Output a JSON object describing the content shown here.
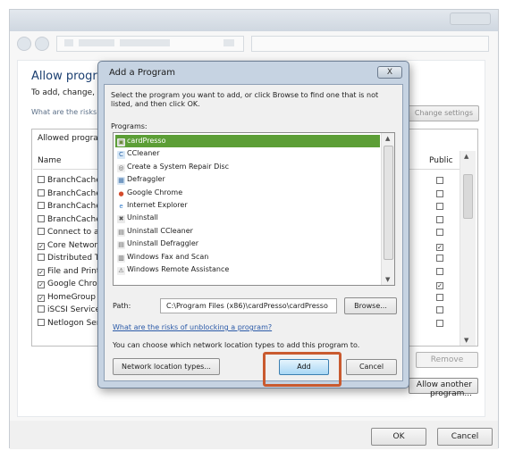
{
  "window": {
    "title": "Allow programs to communicate through Windows Firewall",
    "subtitle": "To add, change, or remove allowed programs and ports, click Change settings.",
    "risk_link": "What are the risks of allowing a program to communicate?",
    "change_settings": "Change settings",
    "list_caption": "Allowed programs and features:",
    "col_name": "Name",
    "col_public": "Public",
    "rows": [
      {
        "label": "BranchCache - Content Retrieval (Uses HTTP)",
        "checked": false,
        "public": false
      },
      {
        "label": "BranchCache - Hosted Cache Client (Uses HTTPS)",
        "checked": false,
        "public": false
      },
      {
        "label": "BranchCache - Hosted Cache Server (Uses HTTPS)",
        "checked": false,
        "public": false
      },
      {
        "label": "BranchCache - Peer Discovery (Uses WSD)",
        "checked": false,
        "public": false
      },
      {
        "label": "Connect to a Network Projector",
        "checked": false,
        "public": false
      },
      {
        "label": "Core Networking",
        "checked": true,
        "public": true
      },
      {
        "label": "Distributed Transaction Coordinator",
        "checked": false,
        "public": false
      },
      {
        "label": "File and Printer Sharing",
        "checked": true,
        "public": false
      },
      {
        "label": "Google Chrome",
        "checked": true,
        "public": true
      },
      {
        "label": "HomeGroup",
        "checked": true,
        "public": false
      },
      {
        "label": "iSCSI Service",
        "checked": false,
        "public": false
      },
      {
        "label": "Netlogon Service",
        "checked": false,
        "public": false
      }
    ],
    "remove": "Remove",
    "allow_another": "Allow another program...",
    "ok": "OK",
    "cancel": "Cancel"
  },
  "dialog": {
    "title": "Add a Program",
    "close": "X",
    "instruction": "Select the program you want to add, or click Browse to find one that is not listed, and then click OK.",
    "programs_label": "Programs:",
    "programs": [
      {
        "name": "cardPresso",
        "icon": "cardpresso-icon",
        "selected": true
      },
      {
        "name": "CCleaner",
        "icon": "ccleaner-icon",
        "selected": false
      },
      {
        "name": "Create a System Repair Disc",
        "icon": "repair-disc-icon",
        "selected": false
      },
      {
        "name": "Defraggler",
        "icon": "defraggler-icon",
        "selected": false
      },
      {
        "name": "Google Chrome",
        "icon": "chrome-icon",
        "selected": false
      },
      {
        "name": "Internet Explorer",
        "icon": "ie-icon",
        "selected": false
      },
      {
        "name": "Uninstall",
        "icon": "uninstall-icon",
        "selected": false
      },
      {
        "name": "Uninstall CCleaner",
        "icon": "uninstall-ccleaner-icon",
        "selected": false
      },
      {
        "name": "Uninstall Defraggler",
        "icon": "uninstall-defraggler-icon",
        "selected": false
      },
      {
        "name": "Windows Fax and Scan",
        "icon": "fax-scan-icon",
        "selected": false
      },
      {
        "name": "Windows Remote Assistance",
        "icon": "remote-assistance-icon",
        "selected": false
      }
    ],
    "path_label": "Path:",
    "path_value": "C:\\Program Files (x86)\\cardPresso\\cardPresso",
    "browse": "Browse...",
    "risk_link": "What are the risks of unblocking a program?",
    "location_text": "You can choose which network location types to add this program to.",
    "network_location": "Network location types...",
    "add": "Add",
    "cancel": "Cancel"
  },
  "colors": {
    "selection": "#5c9e36",
    "highlight": "#c95a2f",
    "title_blue": "#1a3e70"
  }
}
